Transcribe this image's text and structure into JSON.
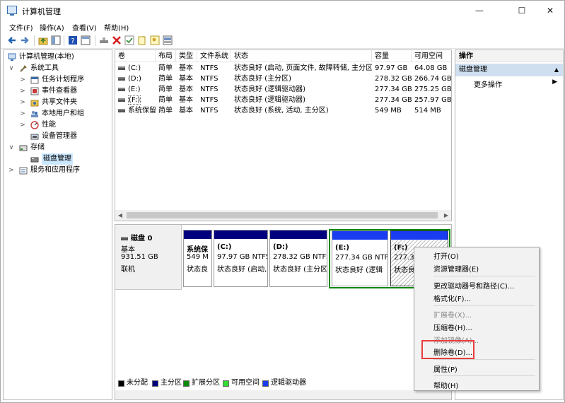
{
  "window": {
    "title": "计算机管理",
    "minimize": "—",
    "maximize": "☐",
    "close": "✕"
  },
  "menubar": [
    "文件(F)",
    "操作(A)",
    "查看(V)",
    "帮助(H)"
  ],
  "tree": [
    {
      "label": "计算机管理(本地)",
      "level": 0,
      "expander": "",
      "icon": "computer-icon"
    },
    {
      "label": "系统工具",
      "level": 1,
      "expander": "∨",
      "icon": "tools-icon"
    },
    {
      "label": "任务计划程序",
      "level": 2,
      "expander": ">",
      "icon": "task-scheduler-icon"
    },
    {
      "label": "事件查看器",
      "level": 2,
      "expander": ">",
      "icon": "event-viewer-icon"
    },
    {
      "label": "共享文件夹",
      "level": 2,
      "expander": ">",
      "icon": "shared-folder-icon"
    },
    {
      "label": "本地用户和组",
      "level": 2,
      "expander": ">",
      "icon": "users-icon"
    },
    {
      "label": "性能",
      "level": 2,
      "expander": ">",
      "icon": "performance-icon"
    },
    {
      "label": "设备管理器",
      "level": 2,
      "expander": "",
      "icon": "device-manager-icon"
    },
    {
      "label": "存储",
      "level": 1,
      "expander": "∨",
      "icon": "storage-icon"
    },
    {
      "label": "磁盘管理",
      "level": 2,
      "expander": "",
      "icon": "disk-icon",
      "selected": true
    },
    {
      "label": "服务和应用程序",
      "level": 1,
      "expander": ">",
      "icon": "services-icon"
    }
  ],
  "volume_list": {
    "headers": [
      "卷",
      "布局",
      "类型",
      "文件系统",
      "状态",
      "容量",
      "可用空间"
    ],
    "rows": [
      [
        "(C:)",
        "简单",
        "基本",
        "NTFS",
        "状态良好 (启动, 页面文件, 故障转储, 主分区)",
        "97.97 GB",
        "64.08 GB"
      ],
      [
        "(D:)",
        "简单",
        "基本",
        "NTFS",
        "状态良好 (主分区)",
        "278.32 GB",
        "266.74 GB"
      ],
      [
        "(E:)",
        "简单",
        "基本",
        "NTFS",
        "状态良好 (逻辑驱动器)",
        "277.34 GB",
        "275.25 GB"
      ],
      [
        "(F:)",
        "简单",
        "基本",
        "NTFS",
        "状态良好 (逻辑驱动器)",
        "277.34 GB",
        "257.97 GB"
      ],
      [
        "系统保留",
        "简单",
        "基本",
        "NTFS",
        "状态良好 (系统, 活动, 主分区)",
        "549 MB",
        "514 MB"
      ]
    ]
  },
  "disk": {
    "name": "磁盘 0",
    "type": "基本",
    "size": "931.51 GB",
    "status": "联机",
    "partitions": [
      {
        "name": "系统保",
        "line2": "549 M",
        "line3": "状态良"
      },
      {
        "name": "(C:)",
        "line2": "97.97 GB NTFS",
        "line3": "状态良好 (启动,"
      },
      {
        "name": "(D:)",
        "line2": "278.32 GB NTFS",
        "line3": "状态良好 (主分区"
      },
      {
        "name": "(E:)",
        "line2": "277.34 GB NTF",
        "line3": "状态良好 (逻辑"
      },
      {
        "name": "(F:)",
        "line2": "277.34",
        "line3": "状态良"
      }
    ]
  },
  "legend": [
    {
      "label": "未分配",
      "color": "#000000"
    },
    {
      "label": "主分区",
      "color": "#00007f"
    },
    {
      "label": "扩展分区",
      "color": "#0b8a0b"
    },
    {
      "label": "可用空间",
      "color": "#33dd33"
    },
    {
      "label": "逻辑驱动器",
      "color": "#1a3cf0"
    }
  ],
  "actions": {
    "header": "操作",
    "selected": "磁盘管理",
    "more": "更多操作"
  },
  "context_menu": [
    {
      "label": "打开(O)",
      "disabled": false
    },
    {
      "label": "资源管理器(E)",
      "disabled": false
    },
    {
      "label": "更改驱动器号和路径(C)...",
      "disabled": false
    },
    {
      "label": "格式化(F)...",
      "disabled": false
    },
    {
      "label": "扩展卷(X)...",
      "disabled": true
    },
    {
      "label": "压缩卷(H)...",
      "disabled": false
    },
    {
      "label": "添加镜像(A)...",
      "disabled": true
    },
    {
      "label": "删除卷(D)...",
      "disabled": false
    },
    {
      "label": "属性(P)",
      "disabled": false
    },
    {
      "label": "帮助(H)",
      "disabled": false
    }
  ],
  "colors": {
    "highlight": "#e83c3c",
    "primary": "#00007f",
    "logical": "#1a3cf0",
    "extended": "#0b8a0b"
  }
}
